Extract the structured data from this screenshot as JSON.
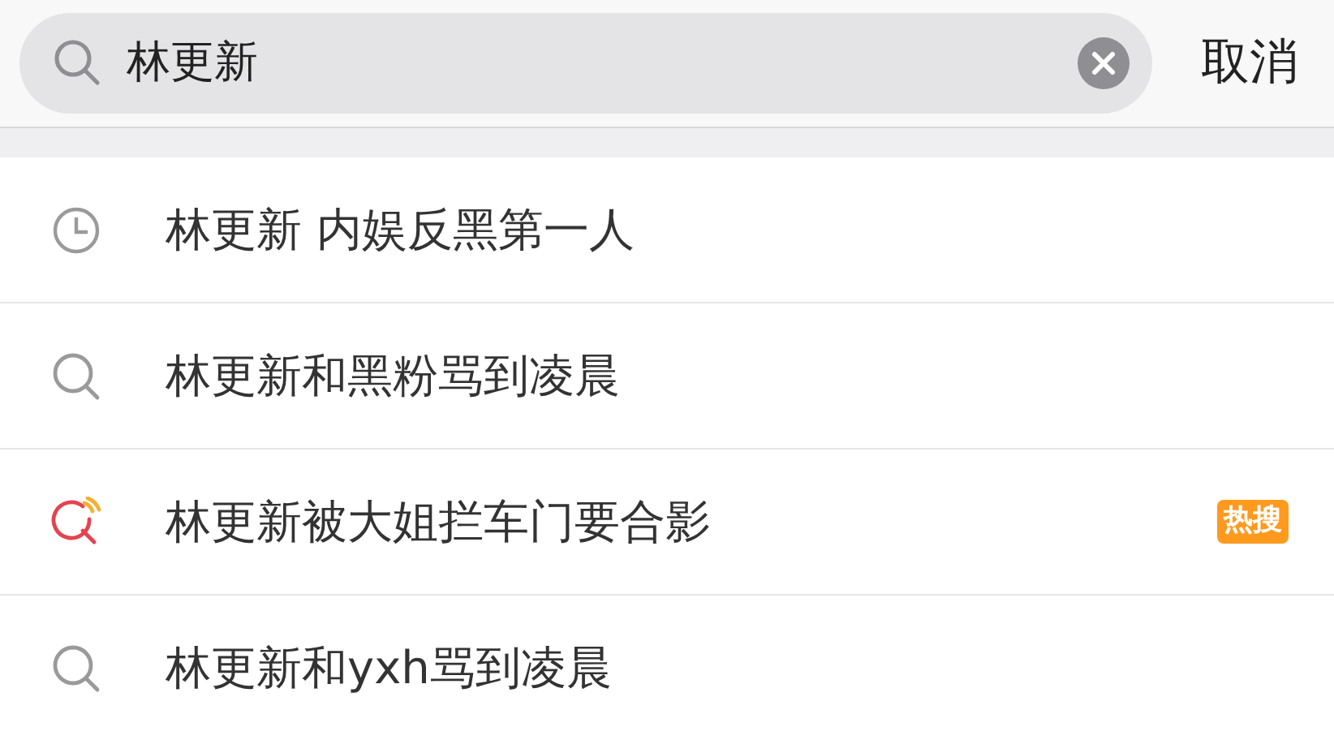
{
  "search": {
    "value": "林更新",
    "cancel": "取消"
  },
  "suggestions": [
    {
      "kind": "history",
      "text": "林更新 内娱反黑第一人"
    },
    {
      "kind": "search",
      "text": "林更新和黑粉骂到凌晨"
    },
    {
      "kind": "hot",
      "text": "林更新被大姐拦车门要合影",
      "badge": "热搜"
    },
    {
      "kind": "search",
      "text": "林更新和yxh骂到凌晨"
    }
  ]
}
